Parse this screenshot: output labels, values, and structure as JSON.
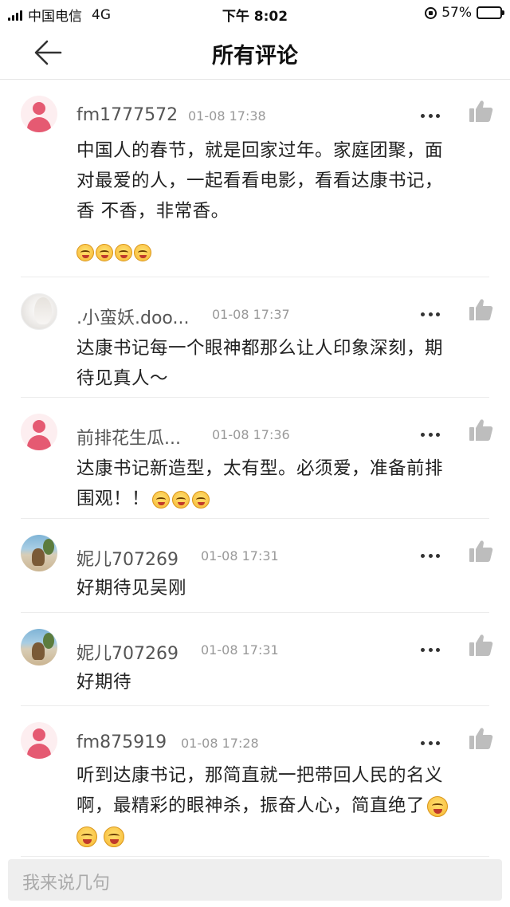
{
  "status_bar": {
    "carrier": "中国电信",
    "network": "4G",
    "time": "下午 8:02",
    "battery": "57%",
    "battery_level": 0.57
  },
  "nav": {
    "title": "所有评论",
    "back_icon": "back-arrow-icon"
  },
  "comments": [
    {
      "user": "fm1777572",
      "time": "01-08 17:38",
      "avatar": "default",
      "lines": [
        "中国人的春节，就是回家过年。家庭团聚，面",
        "对最爱的人，一起看看电影，看看达康书记，",
        "香 不香，非常香。"
      ],
      "emoji_count": 4
    },
    {
      "user": ".小蛮妖.doo...",
      "time": "01-08 17:37",
      "avatar": "fairy",
      "lines": [
        "达康书记每一个眼神都那么让人印象深刻，期",
        "待见真人～"
      ],
      "emoji_count": 0
    },
    {
      "user": "前排花生瓜...",
      "time": "01-08 17:36",
      "avatar": "default",
      "lines": [
        "达康书记新造型，太有型。必须爱，准备前排",
        "围观！！"
      ],
      "emoji_count": 3
    },
    {
      "user": "妮儿707269",
      "time": "01-08 17:31",
      "avatar": "photo",
      "lines": [
        "好期待见吴刚"
      ],
      "emoji_count": 0
    },
    {
      "user": "妮儿707269",
      "time": "01-08 17:31",
      "avatar": "photo",
      "lines": [
        "好期待"
      ],
      "emoji_count": 0
    },
    {
      "user": "fm875919",
      "time": "01-08 17:28",
      "avatar": "default",
      "lines": [
        "听到达康书记，那简直就一把带回人民的名义",
        "啊，最精彩的眼神杀，振奋人心，简直绝了"
      ],
      "emoji_count": 3
    }
  ],
  "input": {
    "placeholder": "我来说几句"
  },
  "icons": {
    "more": "more-dots-icon",
    "like": "thumbs-up-icon"
  },
  "colors": {
    "avatar_default": "#e55a72",
    "like_icon": "#bdbdbd"
  }
}
